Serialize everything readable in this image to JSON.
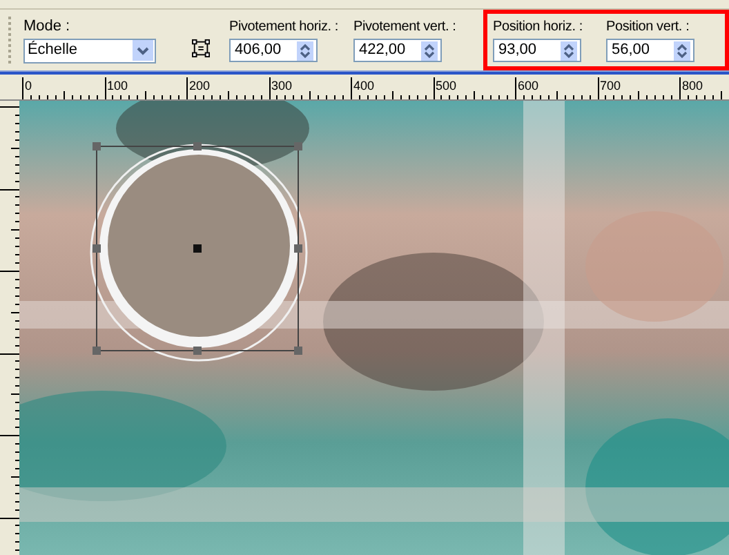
{
  "toolbar": {
    "mode": {
      "label": "Mode :",
      "value": "Échelle"
    },
    "fields": [
      {
        "label": "Pivotement horiz. :",
        "value": "406,00",
        "highlighted": false
      },
      {
        "label": "Pivotement vert. :",
        "value": "422,00",
        "highlighted": false
      },
      {
        "label": "Position horiz. :",
        "value": "93,00",
        "highlighted": true
      },
      {
        "label": "Position vert. :",
        "value": "56,00",
        "highlighted": true
      }
    ]
  },
  "ruler": {
    "labels": [
      "0",
      "100",
      "200",
      "300",
      "400",
      "500",
      "600",
      "700",
      "800"
    ]
  }
}
